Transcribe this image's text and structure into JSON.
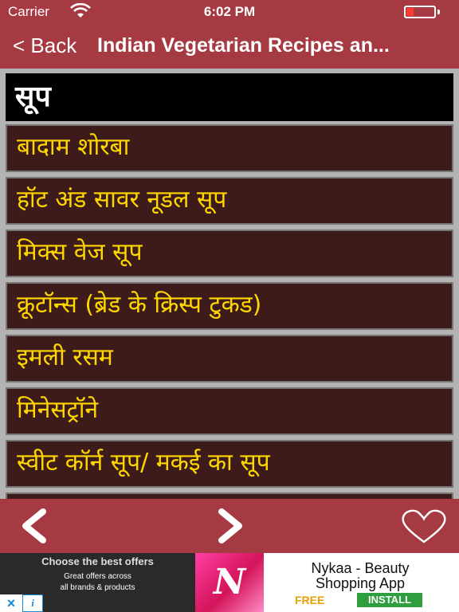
{
  "status_bar": {
    "carrier": "Carrier",
    "time": "6:02 PM",
    "battery_color": "#ff3b30"
  },
  "nav": {
    "back_label": "< Back",
    "title": "Indian Vegetarian Recipes an..."
  },
  "section": {
    "header": "सूप"
  },
  "recipes": [
    "बादाम शोरबा",
    "हॉट अंड सावर नूडल सूप",
    "मिक्स वेज सूप",
    "क्रूटॉन्स (ब्रेड के क्रिस्प टुकड)",
    "इमली रसम",
    "मिनेसट्रॉने",
    "स्वीट कॉर्न सूप/ मकई का सूप"
  ],
  "toolbar": {
    "icons": [
      "chevron-left-icon",
      "chevron-right-icon",
      "heart-icon"
    ]
  },
  "ad": {
    "headline": "Choose the best offers",
    "sub_line1": "Great offers across",
    "sub_line2": "all brands & products",
    "logo_letter": "N",
    "app_name_line1": "Nykaa - Beauty",
    "app_name_line2": "Shopping App",
    "price": "FREE",
    "install_label": "INSTALL",
    "close_label": "×",
    "info_label": "i"
  },
  "colors": {
    "brand": "#a63a43",
    "row_bg": "#3c1b1a",
    "row_text": "#ffd700",
    "header_bg": "#000000"
  }
}
